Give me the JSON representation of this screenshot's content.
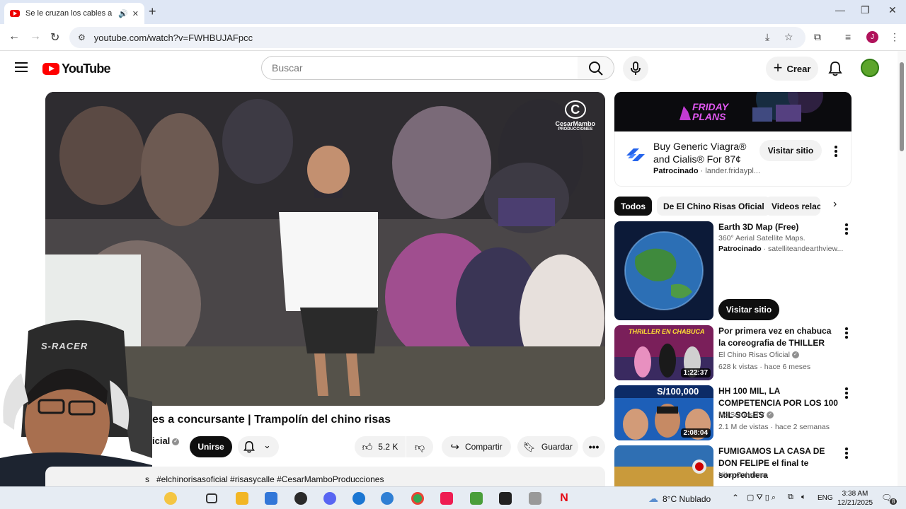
{
  "browser": {
    "tab_title": "Se le cruzan los cables a co",
    "url": "youtube.com/watch?v=FWHBUJAFpcc",
    "profile_initial": "J"
  },
  "youtube": {
    "logo_text": "YouTube",
    "search_placeholder": "Buscar",
    "create_label": "Crear"
  },
  "video": {
    "watermark_line1": "CesarMambo",
    "watermark_line2": "PRODUCCIONES",
    "title_visible": "es a concursante | Trampolín del chino risas",
    "channel_fragment": "icial",
    "join_label": "Unirse",
    "likes": "5.2 K",
    "share_label": "Compartir",
    "save_label": "Guardar",
    "hashtags_prefix": "s",
    "hashtags": "#elchinorisasoficial #risasycalle #CesarMamboProducciones",
    "webcam_chair_text": "S-RACER"
  },
  "ad": {
    "banner_text_1": "FRIDAY",
    "banner_text_2": "PLANS",
    "title": "Buy Generic Viagra® and Cialis® For 87¢",
    "sponsored": "Patrocinado",
    "domain": "lander.fridaypl...",
    "visit_label": "Visitar sitio"
  },
  "chips": [
    "Todos",
    "De El Chino Risas Oficial",
    "Videos relac"
  ],
  "recommendations": [
    {
      "title": "Earth 3D Map (Free)",
      "meta1": "360° Aerial Satellite Maps.",
      "sponsored": "Patrocinado",
      "domain": "satelliteandearthview...",
      "cta": "Visitar sitio"
    },
    {
      "title": "Por primera vez en chabuca la coreografia de THILLER",
      "channel": "El Chino Risas Oficial",
      "stats": "628 k vistas · hace 6 meses",
      "duration": "1:22:37",
      "thumb_text": "THRILLER EN CHABUCA"
    },
    {
      "title": "HH 100 MIL, LA COMPETENCIA POR LOS 100 MIL SOLES",
      "channel": "No Somos TV",
      "stats": "2.1 M de vistas · hace 2 semanas",
      "duration": "2:08:04",
      "thumb_text": "S/100,000"
    },
    {
      "title": "FUMIGAMOS LA CASA DE DON FELIPE el final te sorprendera",
      "channel": "Nitro Cahuana"
    }
  ],
  "taskbar": {
    "weather": "8°C  Nublado",
    "lang": "ENG",
    "time": "3:38 AM",
    "date": "12/21/2025",
    "notif_count": "8"
  }
}
